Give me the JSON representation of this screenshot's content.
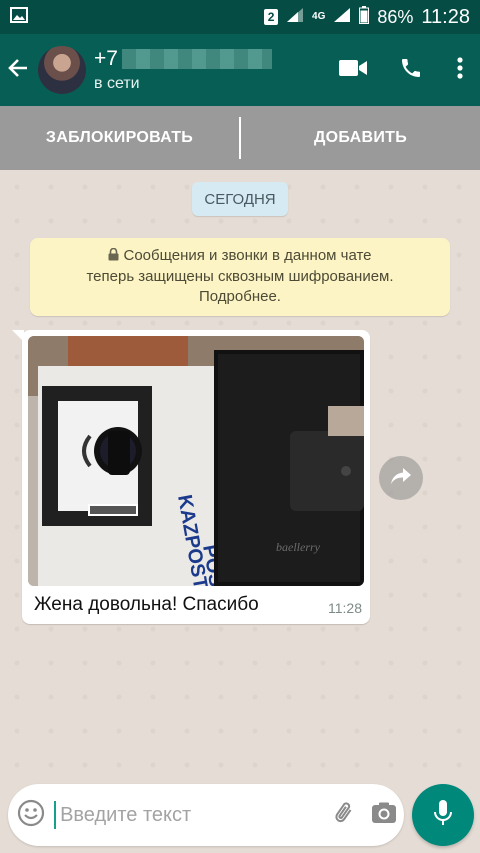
{
  "status_bar": {
    "sim_slot": "2",
    "network_type": "4G",
    "battery": "86%",
    "time": "11:28"
  },
  "header": {
    "contact_name": "+7",
    "contact_status": "в сети"
  },
  "actions": {
    "block_label": "ЗАБЛОКИРОВАТЬ",
    "add_label": "ДОБАВИТЬ"
  },
  "chat": {
    "date_label": "СЕГОДНЯ",
    "encryption_notice": {
      "line1": "Сообщения и звонки в данном чате",
      "line2": "теперь защищены сквозным шифрованием.",
      "line3": "Подробнее."
    },
    "message": {
      "caption": "Жена довольна! Спасибо",
      "time": "11:28"
    }
  },
  "composer": {
    "placeholder": "Введите текст"
  },
  "colors": {
    "header": "#075e54",
    "status_bar": "#054d44",
    "accent": "#00897b",
    "chat_background": "#e5ddd5",
    "notice_background": "#fcf4c4"
  }
}
